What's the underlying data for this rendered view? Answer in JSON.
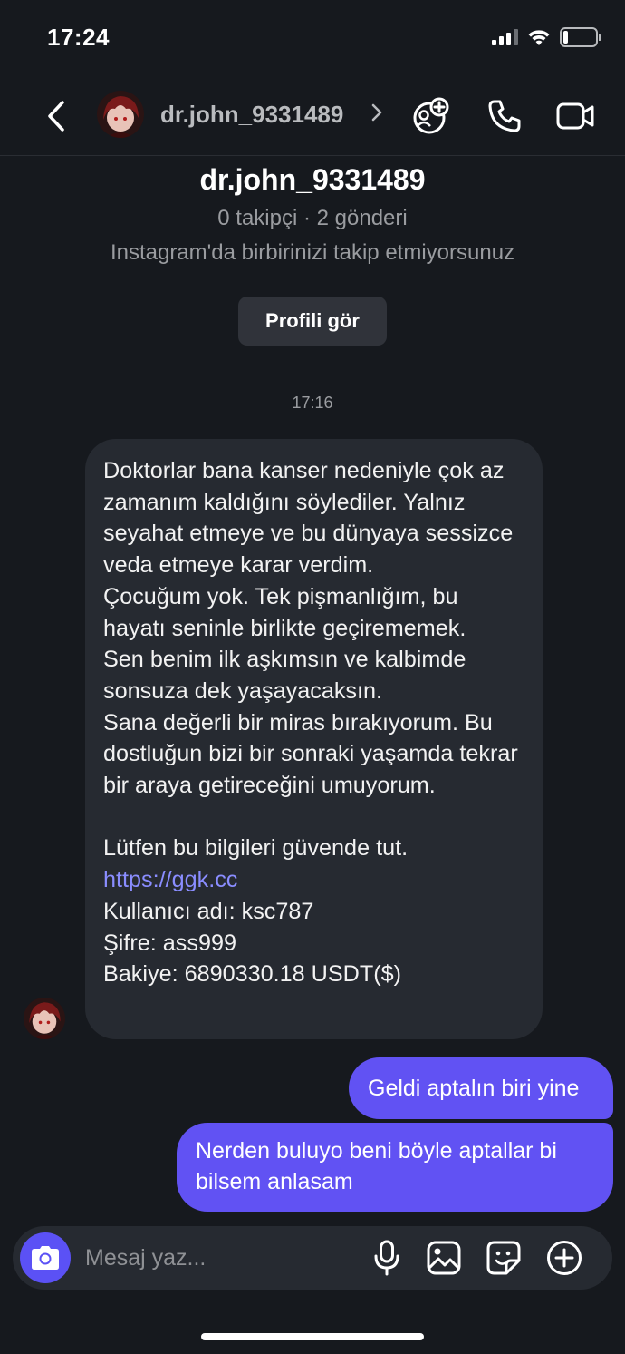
{
  "status_bar": {
    "time": "17:24",
    "battery_level": 0.15
  },
  "nav": {
    "username": "dr.john_9331489",
    "icons": [
      "back-chevron-icon",
      "avatar",
      "chevron-right-icon",
      "add-friend-icon",
      "phone-icon",
      "video-camera-icon"
    ]
  },
  "profile": {
    "name": "dr.john_9331489",
    "stats": "0 takipçi · 2 gönderi",
    "note": "Instagram'da birbirinizi takip etmiyorsunuz",
    "view_profile_label": "Profili gör"
  },
  "chat": {
    "timestamp": "17:16",
    "incoming": {
      "paragraph1": "Doktorlar bana kanser nedeniyle çok az zamanım kaldığını söylediler. Yalnız seyahat etmeye ve bu dünyaya sessizce veda etmeye karar verdim.",
      "paragraph2": "Çocuğum yok. Tek pişmanlığım, bu hayatı seninle birlikte geçirememek.",
      "paragraph3": "Sen benim ilk aşkımsın ve kalbimde sonsuza dek yaşayacaksın.",
      "paragraph4": "Sana değerli bir miras bırakıyorum. Bu dostluğun bizi bir sonraki yaşamda tekrar bir araya getireceğini umuyorum.",
      "paragraph5": "Lütfen bu bilgileri güvende tut.",
      "link": "https://ggk.cc",
      "username_line": "Kullanıcı adı: ksc787",
      "password_line": "Şifre: ass999",
      "balance_line": "Bakiye: 6890330.18 USDT($)"
    },
    "outgoing": [
      "Geldi aptalın biri yine",
      "Nerden buluyo beni böyle aptallar bi bilsem anlasam"
    ]
  },
  "composer": {
    "placeholder": "Mesaj yaz...",
    "icons": [
      "camera-icon",
      "microphone-icon",
      "gallery-icon",
      "sticker-icon",
      "add-icon"
    ]
  },
  "colors": {
    "background": "#16191e",
    "incoming_bubble": "#262a31",
    "outgoing_bubble": "#6152f3",
    "link": "#8a8dff",
    "accent": "#5b51f5"
  }
}
